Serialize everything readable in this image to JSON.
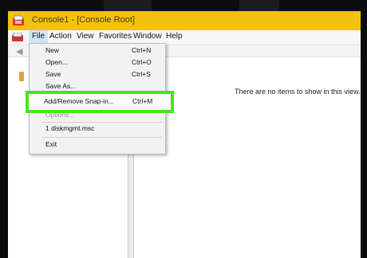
{
  "window": {
    "title": "Console1 - [Console Root]"
  },
  "menubar": {
    "items": [
      "File",
      "Action",
      "View",
      "Favorites",
      "Window",
      "Help"
    ]
  },
  "right_pane": {
    "empty_message": "There are no items to show in this view."
  },
  "file_menu": {
    "items": [
      {
        "label": "New",
        "shortcut": "Ctrl+N"
      },
      {
        "label": "Open...",
        "shortcut": "Ctrl+O"
      },
      {
        "label": "Save",
        "shortcut": "Ctrl+S"
      },
      {
        "label": "Save As...",
        "shortcut": ""
      },
      {
        "label": "Add/Remove Snap-in...",
        "shortcut": "Ctrl+M"
      },
      {
        "label": "Options...",
        "shortcut": ""
      },
      {
        "label": "1 diskmgmt.msc",
        "shortcut": ""
      },
      {
        "label": "Exit",
        "shortcut": ""
      }
    ]
  },
  "colors": {
    "titlebar": "#f3c20f",
    "highlight": "#44e81a",
    "menu_selected": "#cde6f7"
  }
}
